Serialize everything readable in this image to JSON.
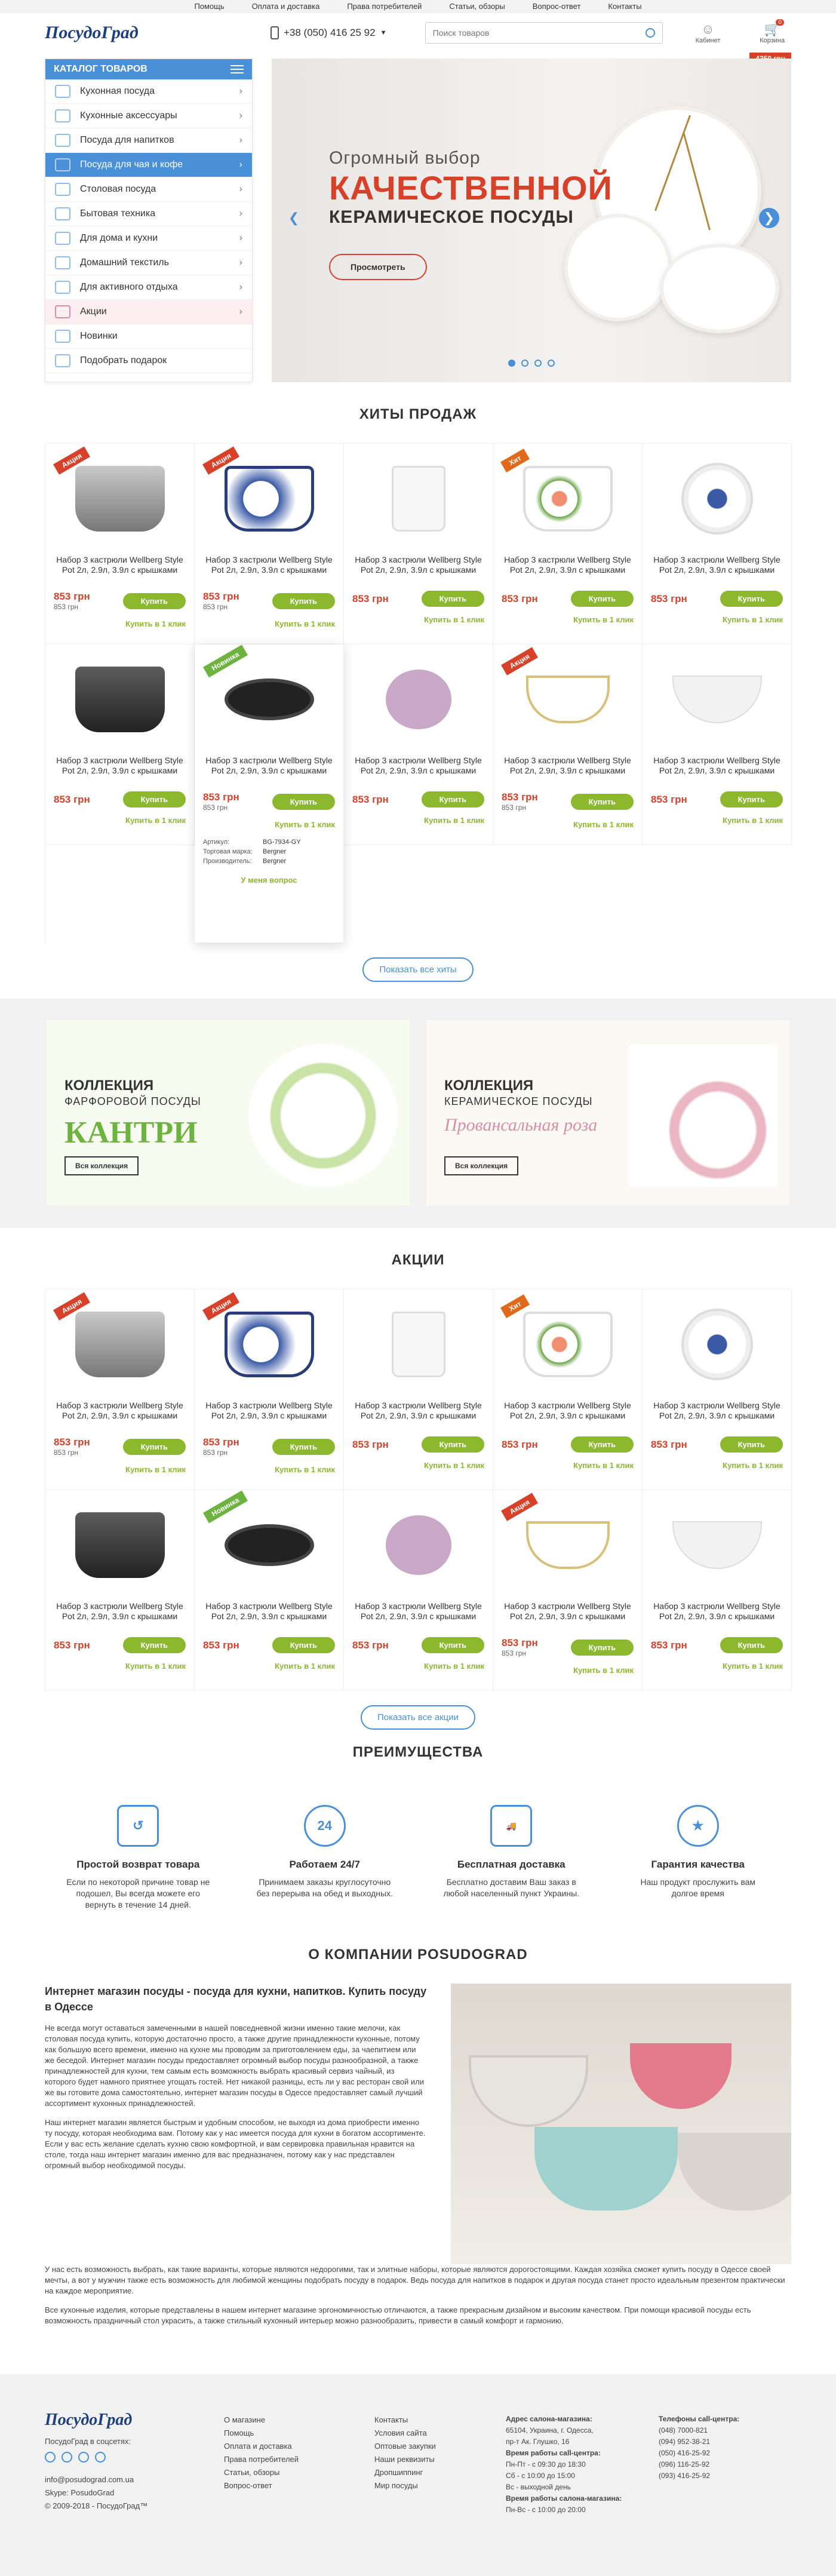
{
  "topnav": [
    "Помощь",
    "Оплата и доставка",
    "Права потребителей",
    "Статьи, обзоры",
    "Вопрос-ответ",
    "Контакты"
  ],
  "header": {
    "logo": "ПосудоГрад",
    "phone": "+38 (050) 416 25 92",
    "search_placeholder": "Поиск товаров",
    "cabinet": "Кабинет",
    "cart": "Корзина",
    "cart_count": "0",
    "cart_total": "4350 грн"
  },
  "catalog": {
    "title": "КАТАЛОГ ТОВАРОВ",
    "items": [
      {
        "label": "Кухонная посуда"
      },
      {
        "label": "Кухонные аксессуары"
      },
      {
        "label": "Посуда для напитков"
      },
      {
        "label": "Посуда для чая и кофе"
      },
      {
        "label": "Столовая посуда"
      },
      {
        "label": "Бытовая техника"
      },
      {
        "label": "Для дома и кухни"
      },
      {
        "label": "Домашний текстиль"
      },
      {
        "label": "Для активного отдыха"
      },
      {
        "label": "Акции"
      },
      {
        "label": "Новинки"
      },
      {
        "label": "Подобрать подарок"
      }
    ]
  },
  "slider": {
    "line1": "Огромный выбор",
    "line2": "КАЧЕСТВЕННОЙ",
    "line3": "КЕРАМИЧЕСКОЕ ПОСУДЫ",
    "button": "Просмотреть"
  },
  "hits": {
    "title": "ХИТЫ ПРОДАЖ",
    "show_all": "Показать все хиты"
  },
  "product": {
    "name": "Набор 3 кастрюли Wellberg Style Pot 2л, 2.9л, 3.9л с крышками",
    "price": "853 грн",
    "buy": "Купить",
    "one_click": "Купить в 1 клик"
  },
  "labels": {
    "sale": "Акция",
    "hit": "Хит",
    "new": "Новинка"
  },
  "specs": {
    "article_label": "Артикул:",
    "article": "BG-7934-GY",
    "brand_label": "Торговая марка:",
    "brand": "Bergner",
    "maker_label": "Производитель:",
    "maker": "Bergner",
    "ask": "У меня вопрос"
  },
  "collections": [
    {
      "t1": "КОЛЛЕКЦИЯ",
      "t2": "ФАРФОРОВОЙ ПОСУДЫ",
      "t3": "КАНТРИ",
      "btn": "Вся коллекция"
    },
    {
      "t1": "КОЛЛЕКЦИЯ",
      "t2": "КЕРАМИЧЕСКОЕ ПОСУДЫ",
      "t3": "Провансальная роза",
      "btn": "Вся коллекция"
    }
  ],
  "sales": {
    "title": "АКЦИИ",
    "show_all": "Показать все акции"
  },
  "advantages": {
    "title": "ПРЕИМУЩЕСТВА",
    "items": [
      {
        "title": "Простой возврат товара",
        "text": "Если по некоторой причине товар не подошел, Вы всегда можете его вернуть в течение 14 дней."
      },
      {
        "title": "Работаем 24/7",
        "text": "Принимаем заказы круглосуточно без перерыва на обед и выходных."
      },
      {
        "title": "Бесплатная доставка",
        "text": "Бесплатно доставим Ваш заказ в любой населенный пункт Украины."
      },
      {
        "title": "Гарантия качества",
        "text": "Наш продукт прослужить вам долгое время"
      }
    ]
  },
  "about": {
    "title": "О КОМПАНИИ POSUDOGRAD",
    "heading": "Интернет магазин посуды - посуда для кухни, напитков. Купить посуду в Одессе",
    "p1": "Не всегда могут оставаться замеченными в нашей повседневной жизни именно такие мелочи, как столовая посуда купить, которую достаточно просто, а также другие принадлежности кухонные, потому как большую всего времени, именно на кухне мы проводим за приготовлением еды, за чаепитием или же беседой. Интернет магазин посуды предоставляет огромный выбор посуды разнообразной, а также принадлежностей для кухни, тем самым есть возможность выбрать красивый сервиз чайный, из которого будет намного приятнее угощать гостей. Нет никакой разницы, есть ли у вас ресторан свой или же вы готовите дома самостоятельно, интернет магазин посуды в Одессе предоставляет самый лучший ассортимент кухонных принадлежностей.",
    "p2": "Наш интернет магазин является быстрым и удобным способом, не выходя из дома приобрести именно ту посуду, которая необходима вам. Потому как у нас имеется посуда для кухни в богатом ассортименте. Если у вас есть желание сделать кухню свою комфортной, и вам сервировка правильная нравится на столе, тогда наш интернет магазин именно для вас предназначен, потому как у нас представлен огромный выбор необходимой посуды.",
    "p3": "У нас есть возможность выбрать, как такие варианты, которые являются недорогими, так и элитные наборы, которые являются дорогостоящими. Каждая хозяйка сможет купить посуду в Одессе своей мечты, а вот у мужчин также есть возможность для любимой женщины подобрать посуду в подарок. Ведь посуда для напитков в подарок и другая посуда станет просто идеальным презентом практически на каждое мероприятие.",
    "p4": "Все кухонные изделия, которые представлены в нашем интернет магазине эргономичностью отличаются, а также прекрасным дизайном и высоким качеством. При помощи красивой посуды есть возможность праздничный стол украсить, а также стильный кухонный интерьер можно разнообразить, привести в самый комфорт и гармонию."
  },
  "footer": {
    "logo": "ПосудоГрад",
    "social_label": "ПосудоГрад в соцсетях:",
    "email": "info@posudograd.com.ua",
    "skype": "Skype: PosudoGrad",
    "copy": "© 2009-2018 - ПосудоГрад™",
    "col1": [
      "О магазине",
      "Помощь",
      "Оплата и доставка",
      "Права потребителей",
      "Статьи, обзоры",
      "Вопрос-ответ"
    ],
    "col2": [
      "Контакты",
      "Условия сайта",
      "Оптовые закупки",
      "Наши реквизиты",
      "Дропшиппинг",
      "Мир посуды"
    ],
    "addr_title": "Адрес салона-магазина:",
    "addr": [
      "65104, Украина, г. Одесса,",
      "пр-т Ак. Глушко, 16"
    ],
    "hours_title": "Время работы call-центра:",
    "hours": [
      "Пн-Пт - с 09:30 до 18:30",
      "Сб - с 10:00 до 15:00",
      "Вс - выходной день"
    ],
    "salon_title": "Время работы салона-магазина:",
    "salon": [
      "Пн-Вс - с 10:00 до 20:00"
    ],
    "phones_title": "Телефоны call-центра:",
    "phones": [
      "(048) 7000-821",
      "(094) 952-38-21",
      "(050) 416-25-92",
      "(096) 116-25-92",
      "(093) 416-25-92"
    ]
  }
}
